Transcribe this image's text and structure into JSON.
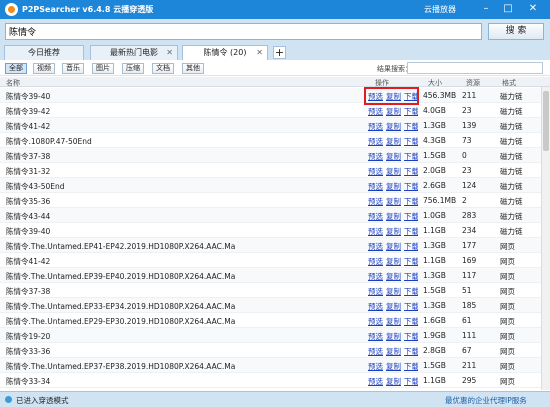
{
  "app": {
    "title": "P2PSearcher v6.4.8 云播穿透版",
    "cloud_player": "云播放器",
    "win_min": "–",
    "win_max": "□",
    "win_close": "✕"
  },
  "search": {
    "query": "陈情令",
    "button": "搜 索"
  },
  "tabs": [
    {
      "label": "今日推荐"
    },
    {
      "label": "最新热门电影"
    },
    {
      "label": "陈情令 (20)",
      "active": true
    }
  ],
  "new_tab": "+",
  "filters": [
    "全部",
    "视频",
    "音乐",
    "图片",
    "压缩",
    "文档",
    "其他"
  ],
  "result_search_label": "结果搜索：",
  "columns": {
    "name": "名称",
    "ops": "操作",
    "size": "大小",
    "res": "资源",
    "fmt": "格式"
  },
  "ops_labels": {
    "play": "预选",
    "copy": "复制",
    "download": "下载"
  },
  "rows": [
    {
      "name": "陈情令39-40",
      "size": "456.3MB",
      "res": "211",
      "fmt": "磁力链"
    },
    {
      "name": "陈情令39-42",
      "size": "4.0GB",
      "res": "23",
      "fmt": "磁力链"
    },
    {
      "name": "陈情令41-42",
      "size": "1.3GB",
      "res": "139",
      "fmt": "磁力链"
    },
    {
      "name": "陈情令.1080P.47-50End",
      "size": "4.3GB",
      "res": "73",
      "fmt": "磁力链"
    },
    {
      "name": "陈情令37-38",
      "size": "1.5GB",
      "res": "0",
      "fmt": "磁力链"
    },
    {
      "name": "陈情令31-32",
      "size": "2.0GB",
      "res": "23",
      "fmt": "磁力链"
    },
    {
      "name": "陈情令43-50End",
      "size": "2.6GB",
      "res": "124",
      "fmt": "磁力链"
    },
    {
      "name": "陈情令35-36",
      "size": "756.1MB",
      "res": "2",
      "fmt": "磁力链"
    },
    {
      "name": "陈情令43-44",
      "size": "1.0GB",
      "res": "283",
      "fmt": "磁力链"
    },
    {
      "name": "陈情令39-40",
      "size": "1.1GB",
      "res": "234",
      "fmt": "磁力链"
    },
    {
      "name": "陈情令.The.Untamed.EP41-EP42.2019.HD1080P.X264.AAC.Ma",
      "size": "1.3GB",
      "res": "177",
      "fmt": "网页"
    },
    {
      "name": "陈情令41-42",
      "size": "1.1GB",
      "res": "169",
      "fmt": "网页"
    },
    {
      "name": "陈情令.The.Untamed.EP39-EP40.2019.HD1080P.X264.AAC.Ma",
      "size": "1.3GB",
      "res": "117",
      "fmt": "网页"
    },
    {
      "name": "陈情令37-38",
      "size": "1.5GB",
      "res": "51",
      "fmt": "网页"
    },
    {
      "name": "陈情令.The.Untamed.EP33-EP34.2019.HD1080P.X264.AAC.Ma",
      "size": "1.3GB",
      "res": "185",
      "fmt": "网页"
    },
    {
      "name": "陈情令.The.Untamed.EP29-EP30.2019.HD1080P.X264.AAC.Ma",
      "size": "1.6GB",
      "res": "61",
      "fmt": "网页"
    },
    {
      "name": "陈情令19-20",
      "size": "1.9GB",
      "res": "111",
      "fmt": "网页"
    },
    {
      "name": "陈情令33-36",
      "size": "2.8GB",
      "res": "67",
      "fmt": "网页"
    },
    {
      "name": "陈情令.The.Untamed.EP37-EP38.2019.HD1080P.X264.AAC.Ma",
      "size": "1.5GB",
      "res": "211",
      "fmt": "网页"
    },
    {
      "name": "陈情令33-34",
      "size": "1.1GB",
      "res": "295",
      "fmt": "网页"
    }
  ],
  "status": {
    "left": "已进入穿透模式",
    "right": "最优惠的企业代理IP服务"
  }
}
